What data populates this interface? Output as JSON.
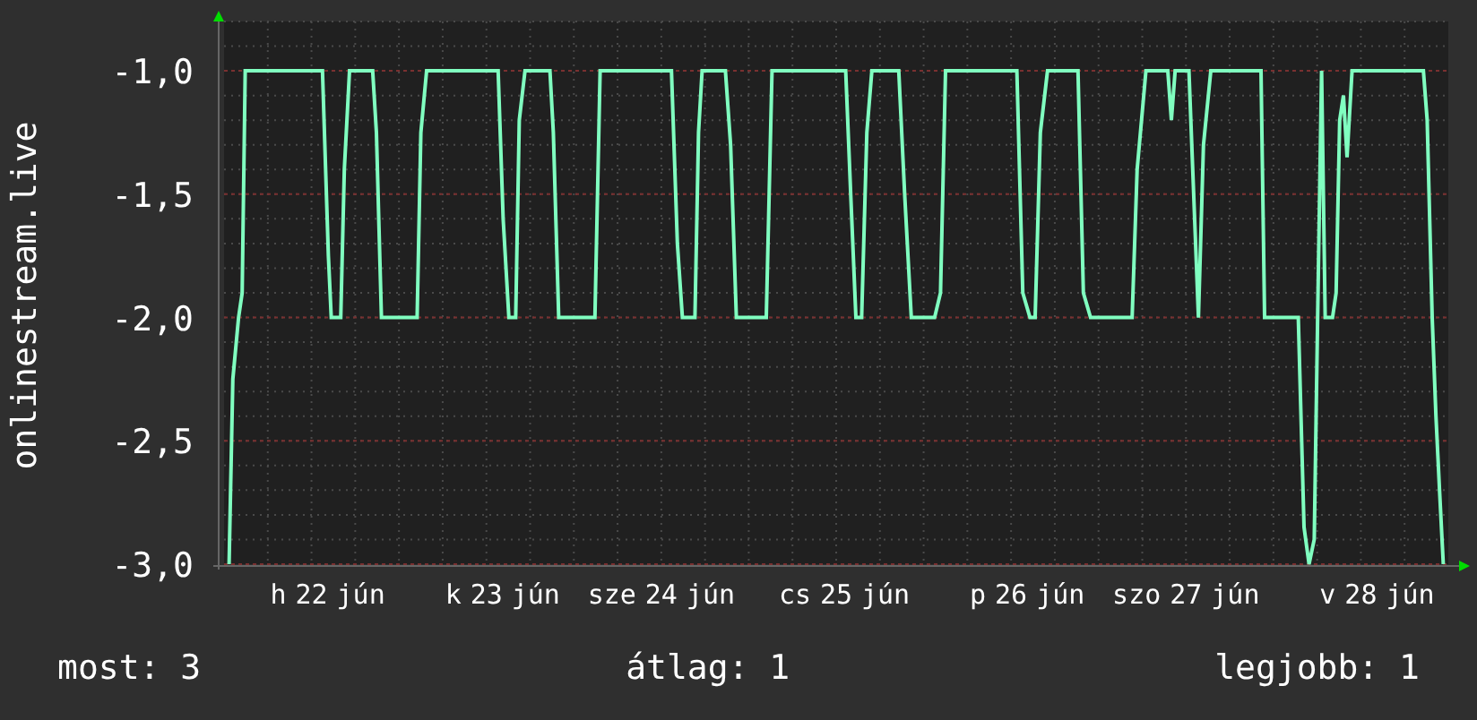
{
  "chart": {
    "weekday_labels": [
      "h",
      "k",
      "sze",
      "cs",
      "p",
      "szo",
      "v"
    ],
    "month_labels": [
      "jún",
      "jún",
      "jún",
      "jún",
      "jún",
      "jún",
      "jún"
    ],
    "chart_data": {
      "type": "line",
      "ylabel": "onlinestream.live",
      "xlim": [
        21.5,
        28.5
      ],
      "grid": true,
      "ylim": [
        -3.0,
        -0.8
      ],
      "yticks": [
        {
          "value": -1.0,
          "label": "-1,0"
        },
        {
          "value": -1.5,
          "label": "-1,5"
        },
        {
          "value": -2.0,
          "label": "-2,0"
        },
        {
          "value": -2.5,
          "label": "-2,5"
        },
        {
          "value": -3.0,
          "label": "-3,0"
        }
      ],
      "xticks": [
        22,
        23,
        24,
        25,
        26,
        27,
        28
      ],
      "x": [
        21.529,
        21.55,
        21.583,
        21.604,
        21.621,
        22.063,
        22.096,
        22.113,
        22.167,
        22.188,
        22.217,
        22.35,
        22.371,
        22.4,
        22.604,
        22.625,
        22.658,
        23.067,
        23.096,
        23.129,
        23.167,
        23.188,
        23.221,
        23.363,
        23.383,
        23.413,
        23.621,
        23.65,
        24.058,
        24.092,
        24.121,
        24.192,
        24.213,
        24.233,
        24.367,
        24.396,
        24.429,
        24.6,
        24.633,
        25.054,
        25.083,
        25.113,
        25.146,
        25.175,
        25.204,
        25.358,
        25.392,
        25.429,
        25.563,
        25.596,
        25.625,
        26.033,
        26.067,
        26.108,
        26.138,
        26.167,
        26.208,
        26.383,
        26.413,
        26.454,
        26.692,
        26.721,
        26.771,
        26.896,
        26.917,
        26.938,
        27.017,
        27.038,
        27.071,
        27.1,
        27.142,
        27.429,
        27.45,
        27.642,
        27.675,
        27.704,
        27.733,
        27.754,
        27.775,
        27.796,
        27.838,
        27.858,
        27.879,
        27.9,
        27.921,
        27.95,
        28.358,
        28.379,
        28.408,
        28.429,
        28.45,
        28.471
      ],
      "series": [
        {
          "color": "#80ffc0",
          "values": [
            -3.0,
            -2.25,
            -2.0,
            -1.9,
            -1.0,
            -1.0,
            -1.75,
            -2.0,
            -2.0,
            -1.4,
            -1.0,
            -1.0,
            -1.25,
            -2.0,
            -2.0,
            -1.25,
            -1.0,
            -1.0,
            -1.6,
            -2.0,
            -2.0,
            -1.2,
            -1.0,
            -1.0,
            -1.25,
            -2.0,
            -2.0,
            -1.0,
            -1.0,
            -1.7,
            -2.0,
            -2.0,
            -1.25,
            -1.0,
            -1.0,
            -1.3,
            -2.0,
            -2.0,
            -1.0,
            -1.0,
            -1.5,
            -2.0,
            -2.0,
            -1.25,
            -1.0,
            -1.0,
            -1.5,
            -2.0,
            -2.0,
            -1.9,
            -1.0,
            -1.0,
            -1.9,
            -2.0,
            -2.0,
            -1.25,
            -1.0,
            -1.0,
            -1.9,
            -2.0,
            -2.0,
            -1.4,
            -1.0,
            -1.0,
            -1.2,
            -1.0,
            -1.0,
            -1.4,
            -2.0,
            -1.3,
            -1.0,
            -1.0,
            -2.0,
            -2.0,
            -2.85,
            -3.0,
            -2.9,
            -1.95,
            -1.0,
            -2.0,
            -2.0,
            -1.9,
            -1.2,
            -1.1,
            -1.35,
            -1.0,
            -1.0,
            -1.2,
            -2.0,
            -2.4,
            -2.7,
            -3.0
          ]
        }
      ]
    }
  },
  "footer": [
    "most: 3",
    "átlag: 1",
    "legjobb: 1"
  ]
}
